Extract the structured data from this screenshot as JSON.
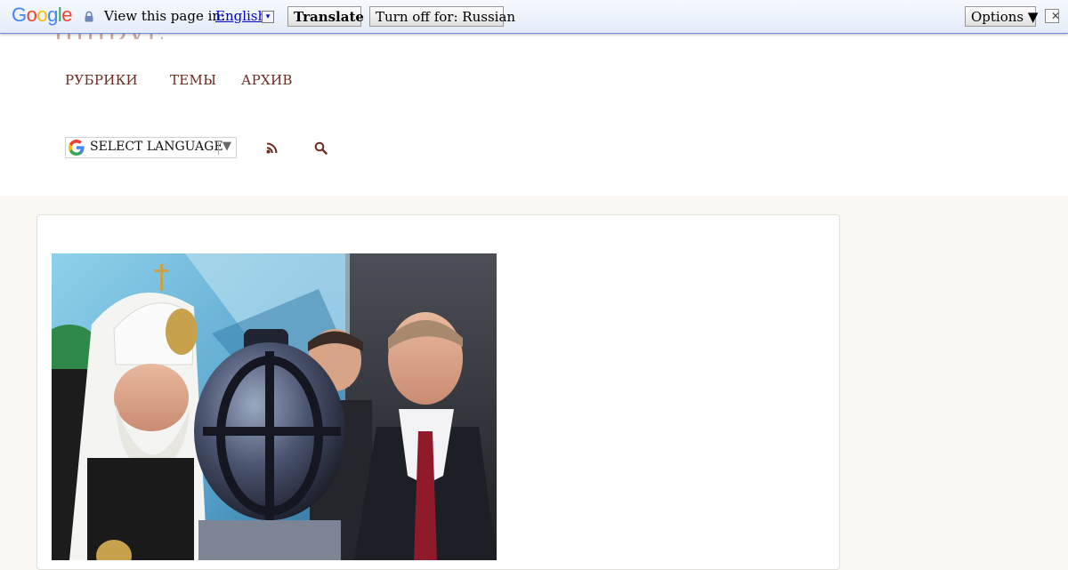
{
  "translate_bar": {
    "logo": "Google",
    "view_label": "View this page in:",
    "language": "English",
    "language_arrow": "▾",
    "translate_button": "Translate",
    "turn_off_button": "Turn off for: Russian",
    "options_button": "Options ▼",
    "close_glyph": "✕"
  },
  "header": {
    "logo_fragment": "IIIIIDVE",
    "nav": [
      "РУБРИКИ",
      "ТЕМЫ",
      "АРХИВ"
    ],
    "language_select": {
      "label": "SELECT LANGUAGE",
      "arrow": "▼"
    },
    "icons": [
      "rss-icon",
      "search-icon"
    ]
  },
  "colors": {
    "nav_text": "#6d2a1f",
    "page_bg": "#fbf8f3",
    "translate_bar_border": "#6b90da",
    "link_blue": "#0000cc"
  }
}
